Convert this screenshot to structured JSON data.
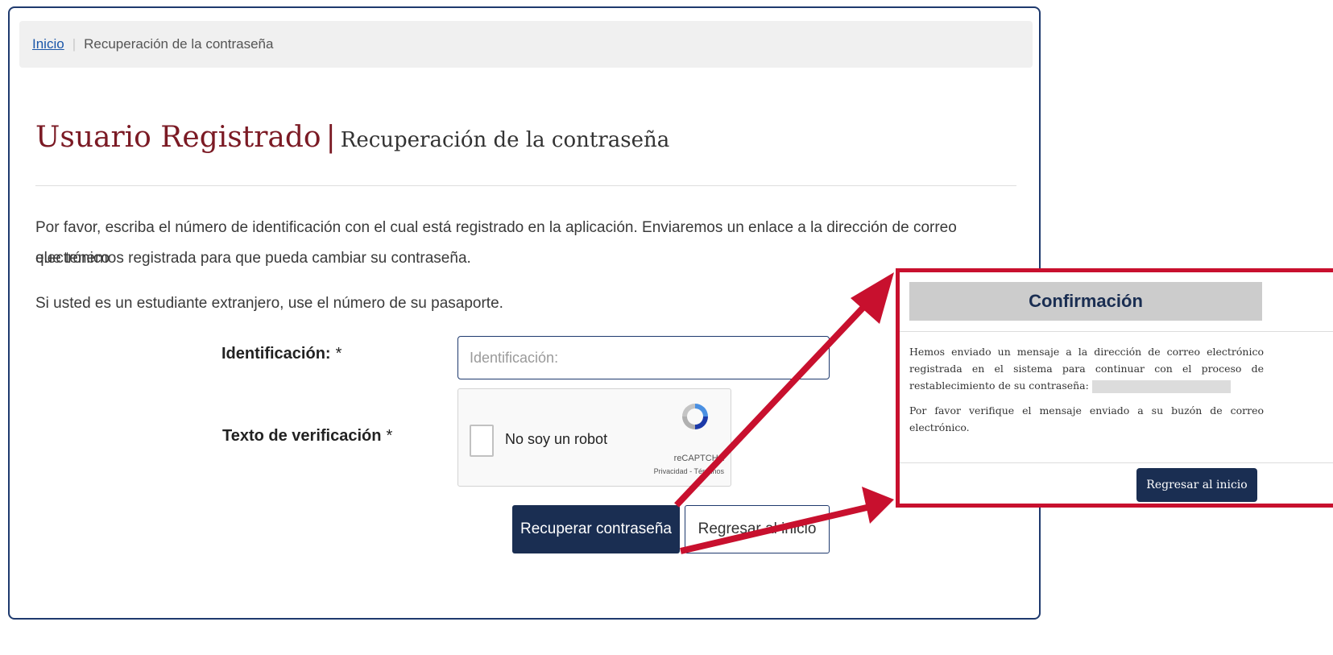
{
  "breadcrumb": {
    "home": "Inicio",
    "separator": "|",
    "current": "Recuperación de la contraseña"
  },
  "page": {
    "title_main": "Usuario Registrado",
    "title_separator": "|",
    "title_sub": "Recuperación de la contraseña",
    "intro_line1": "Por favor, escriba el número de identificación con el cual está registrado en la aplicación. Enviaremos un enlace a la dirección de correo electrónico",
    "intro_line2": "que tenemos registrada para que pueda cambiar su contraseña.",
    "intro_foreign": "Si usted es un estudiante extranjero, use el número de su pasaporte."
  },
  "form": {
    "id_label": "Identificación:",
    "id_placeholder": "Identificación:",
    "required_mark": "*",
    "verification_label": "Texto de verificación",
    "captcha_label": "No soy un robot",
    "captcha_brand": "reCAPTCHA",
    "captcha_links": "Privacidad - Términos",
    "submit_label": "Recuperar contraseña",
    "back_label": "Regresar al inicio"
  },
  "modal": {
    "title": "Confirmación",
    "message1": "Hemos enviado un mensaje a la dirección de correo electrónico registrada en el sistema para continuar con el proceso de restablecimiento de su contraseña:",
    "message2": "Por favor verifique el mensaje enviado a su buzón de correo electrónico.",
    "button_label": "Regresar al inicio"
  },
  "colors": {
    "title_red": "#7b1a24",
    "navy": "#1a2e52",
    "annotation_red": "#c8102e",
    "link_blue": "#1a56a8"
  },
  "icons": {
    "captcha_logo": "recaptcha-icon"
  }
}
